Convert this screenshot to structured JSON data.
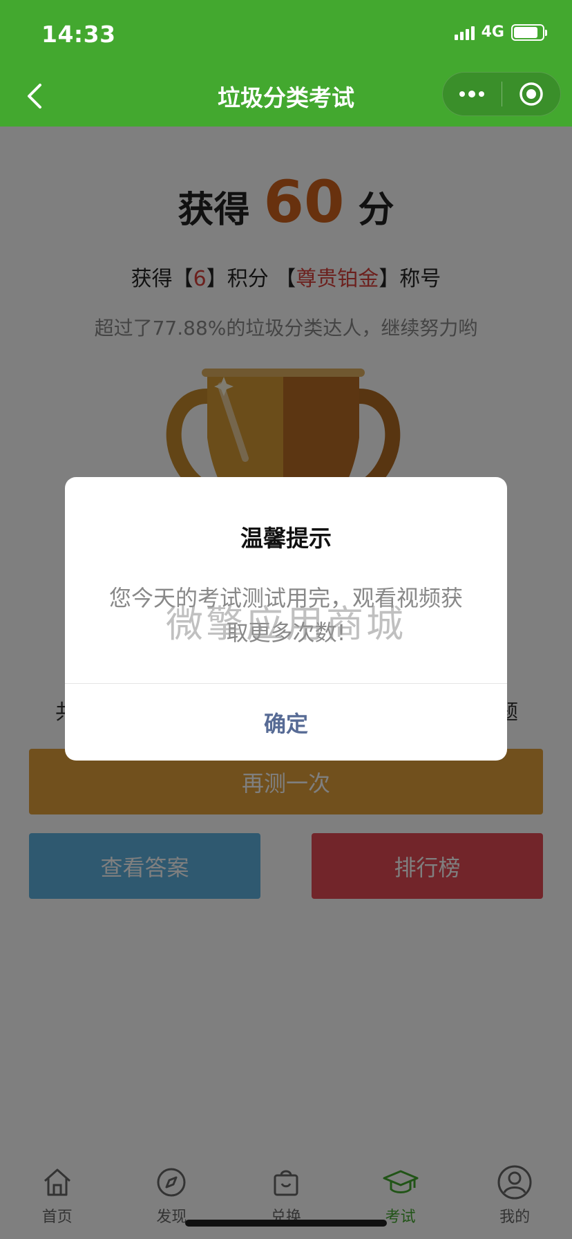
{
  "status_bar": {
    "time": "14:33",
    "network": "4G",
    "battery_level": 0.85
  },
  "nav": {
    "title": "垃圾分类考试",
    "icons": [
      "back-icon",
      "more-dots-icon",
      "record-icon"
    ]
  },
  "result": {
    "score_prefix": "获得",
    "score": "60",
    "score_suffix": "分",
    "points_prefix": "获得【",
    "points": "6",
    "points_mid": "】积分 【",
    "title_name": "尊贵铂金",
    "points_suffix": "】称号",
    "beat_text": "超过了77.88%的垃圾分类达人，继续努力哟",
    "stats_left_partial": "共",
    "stats_right_partial": "题"
  },
  "buttons": {
    "retry": "再测一次",
    "answers": "查看答案",
    "rank": "排行榜"
  },
  "modal": {
    "title": "温馨提示",
    "message": "您今天的考试测试用完，观看视频获取更多次数!",
    "confirm": "确定"
  },
  "watermark": "微擎应用商城",
  "tabbar": {
    "active_index": 3,
    "items": [
      {
        "label": "首页",
        "icon": "home-icon"
      },
      {
        "label": "发现",
        "icon": "compass-icon"
      },
      {
        "label": "兑换",
        "icon": "shopping-bag-icon"
      },
      {
        "label": "考试",
        "icon": "graduation-cap-icon"
      },
      {
        "label": "我的",
        "icon": "user-icon"
      }
    ]
  },
  "colors": {
    "brand_green": "#43a82f",
    "score_orange": "#d0621c",
    "highlight_red": "#d9403a",
    "retry_gold": "#e2a13a",
    "answers_blue": "#5fb3e0",
    "rank_red": "#e54a54",
    "confirm_blue": "#576b95"
  }
}
